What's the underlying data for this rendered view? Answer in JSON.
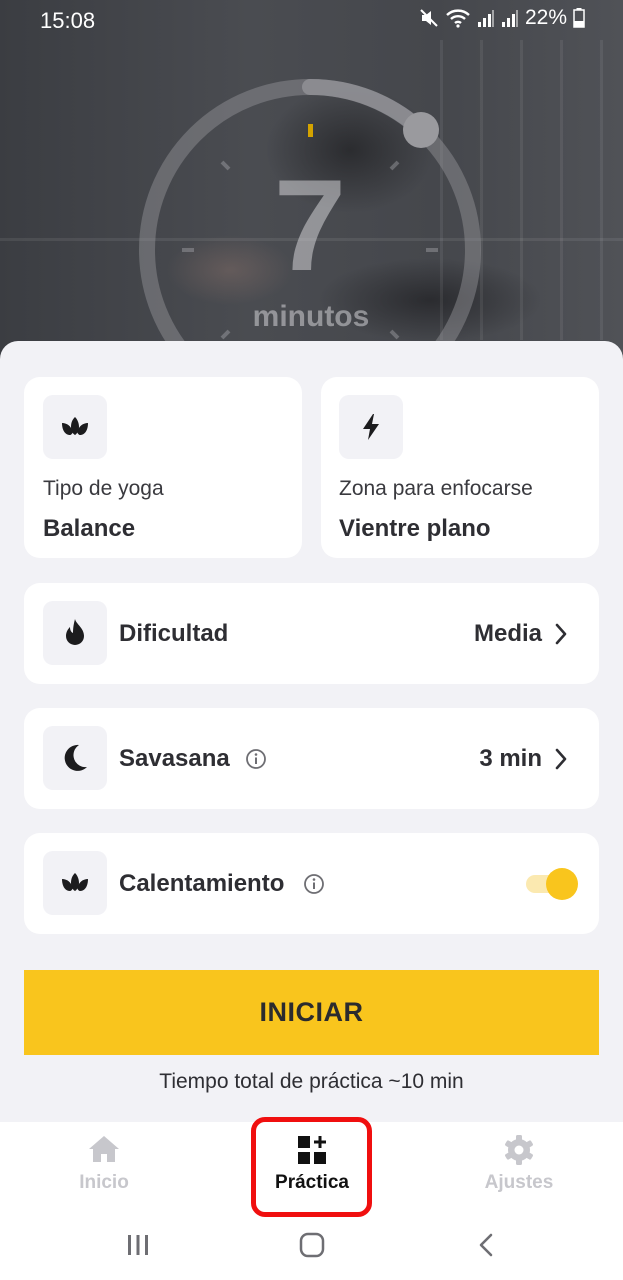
{
  "status_bar": {
    "time": "15:08",
    "battery": "22%"
  },
  "timer": {
    "value": "7",
    "unit": "minutos",
    "progress": 0.18
  },
  "cards": {
    "yoga_type": {
      "label": "Tipo de yoga",
      "value": "Balance",
      "icon": "lotus-icon"
    },
    "focus_zone": {
      "label": "Zona para enfocarse",
      "value": "Vientre plano",
      "icon": "lightning-icon"
    }
  },
  "rows": {
    "difficulty": {
      "label": "Dificultad",
      "value": "Media",
      "icon": "flame-icon"
    },
    "savasana": {
      "label": "Savasana",
      "value": "3 min",
      "icon": "moon-icon"
    },
    "warmup": {
      "label": "Calentamiento",
      "enabled": true,
      "icon": "lotus-icon"
    }
  },
  "start_button": {
    "label": "INICIAR"
  },
  "total_time": "Tiempo total de práctica ~10 min",
  "bottom_nav": [
    {
      "label": "Inicio",
      "icon": "home-icon",
      "active": false
    },
    {
      "label": "Práctica",
      "icon": "practice-grid-icon",
      "active": true
    },
    {
      "label": "Ajustes",
      "icon": "gear-icon",
      "active": false
    }
  ],
  "colors": {
    "accent": "#f9c51d",
    "highlight": "#f00f0f",
    "background": "#f2f2f6"
  }
}
